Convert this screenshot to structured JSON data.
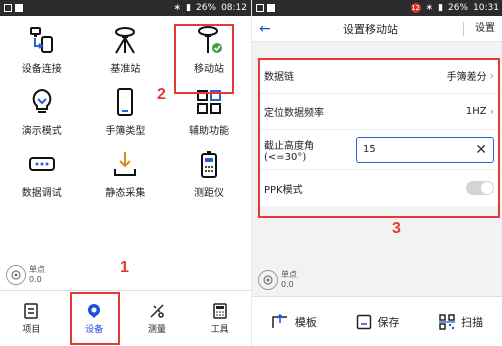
{
  "left": {
    "status": {
      "battery": "26%",
      "time": "08:12"
    },
    "grid": [
      [
        {
          "label": "设备连接",
          "icon": "device-connect-icon"
        },
        {
          "label": "基准站",
          "icon": "base-station-icon"
        },
        {
          "label": "移动站",
          "icon": "rover-station-icon"
        }
      ],
      [
        {
          "label": "演示模式",
          "icon": "demo-bulb-icon"
        },
        {
          "label": "手簿类型",
          "icon": "controller-type-icon"
        },
        {
          "label": "辅助功能",
          "icon": "auxiliary-grid-icon"
        }
      ],
      [
        {
          "label": "数据调试",
          "icon": "data-debug-icon"
        },
        {
          "label": "静态采集",
          "icon": "static-collect-icon"
        },
        {
          "label": "测距仪",
          "icon": "rangefinder-icon"
        }
      ]
    ],
    "point": {
      "label": "单点",
      "value": "0.0"
    },
    "nav": [
      {
        "label": "项目",
        "icon": "project-icon"
      },
      {
        "label": "设备",
        "icon": "device-icon",
        "active": true
      },
      {
        "label": "测量",
        "icon": "measure-icon"
      },
      {
        "label": "工具",
        "icon": "tools-icon"
      }
    ],
    "annotations": {
      "one": "1",
      "two": "2"
    }
  },
  "right": {
    "status": {
      "battery": "26%",
      "time": "10:31",
      "badge": "12"
    },
    "title": "设置移动站",
    "settings_label": "设置",
    "rows": {
      "datalink": {
        "name": "数据链",
        "value": "手簿差分"
      },
      "frequency": {
        "name": "定位数据频率",
        "value": "1HZ"
      },
      "elevation": {
        "name": "截止高度角(<=30°)",
        "value": "15"
      },
      "ppk": {
        "name": "PPK模式",
        "on": false
      }
    },
    "point": {
      "label": "单点",
      "value": "0.0"
    },
    "buttons": {
      "template": "模板",
      "save": "保存",
      "scan": "扫描"
    },
    "annotation": "3"
  },
  "colors": {
    "accent": "#1e50d8",
    "annotation": "#e53935",
    "check": "#43a047"
  }
}
